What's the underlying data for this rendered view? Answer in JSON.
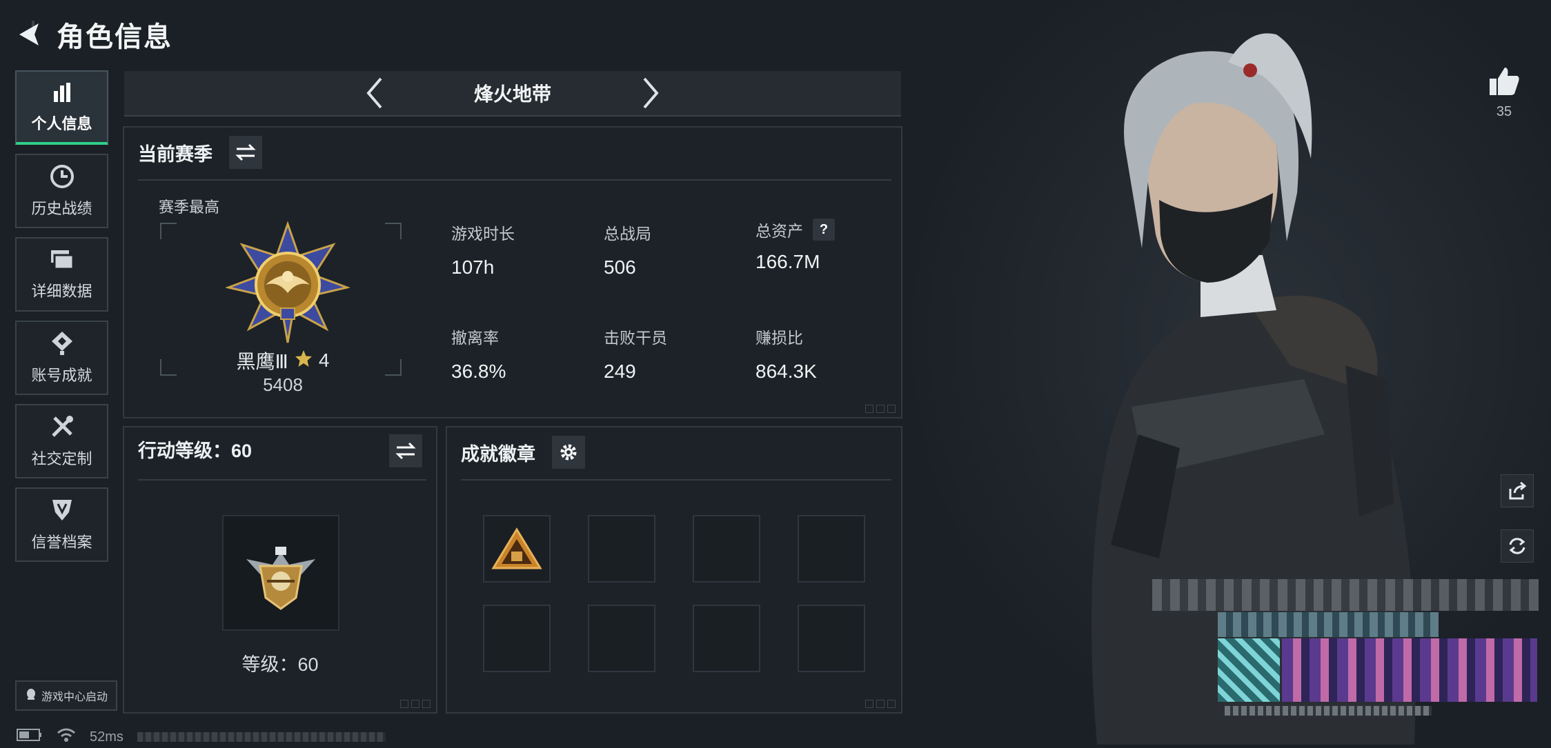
{
  "header": {
    "title": "角色信息"
  },
  "sidebar": {
    "items": [
      {
        "label": "个人信息",
        "icon": "bar-chart-icon",
        "active": true
      },
      {
        "label": "历史战绩",
        "icon": "clock-icon",
        "active": false
      },
      {
        "label": "详细数据",
        "icon": "folder-icon",
        "active": false
      },
      {
        "label": "账号成就",
        "icon": "achievement-icon",
        "active": false
      },
      {
        "label": "社交定制",
        "icon": "tools-icon",
        "active": false
      },
      {
        "label": "信誉档案",
        "icon": "shield-icon",
        "active": false
      }
    ],
    "launch_label": "游戏中心启动"
  },
  "mode": {
    "name": "烽火地带"
  },
  "season": {
    "title": "当前赛季",
    "best_label": "赛季最高",
    "rank_name": "黑鹰Ⅲ",
    "stars": "4",
    "rank_score": "5408",
    "stats": [
      {
        "label": "游戏时长",
        "value": "107h"
      },
      {
        "label": "总战局",
        "value": "506"
      },
      {
        "label": "总资产",
        "value": "166.7M",
        "help": "?"
      },
      {
        "label": "撤离率",
        "value": "36.8%"
      },
      {
        "label": "击败干员",
        "value": "249"
      },
      {
        "label": "赚损比",
        "value": "864.3K"
      }
    ]
  },
  "action_level": {
    "title": "行动等级：60",
    "level_text": "等级：60"
  },
  "achievements": {
    "title": "成就徽章"
  },
  "likes": {
    "count": "35"
  },
  "status": {
    "ping": "52ms"
  },
  "colors": {
    "accent": "#2fd08a",
    "background": "#1b2026",
    "panel": "#1c2227"
  }
}
